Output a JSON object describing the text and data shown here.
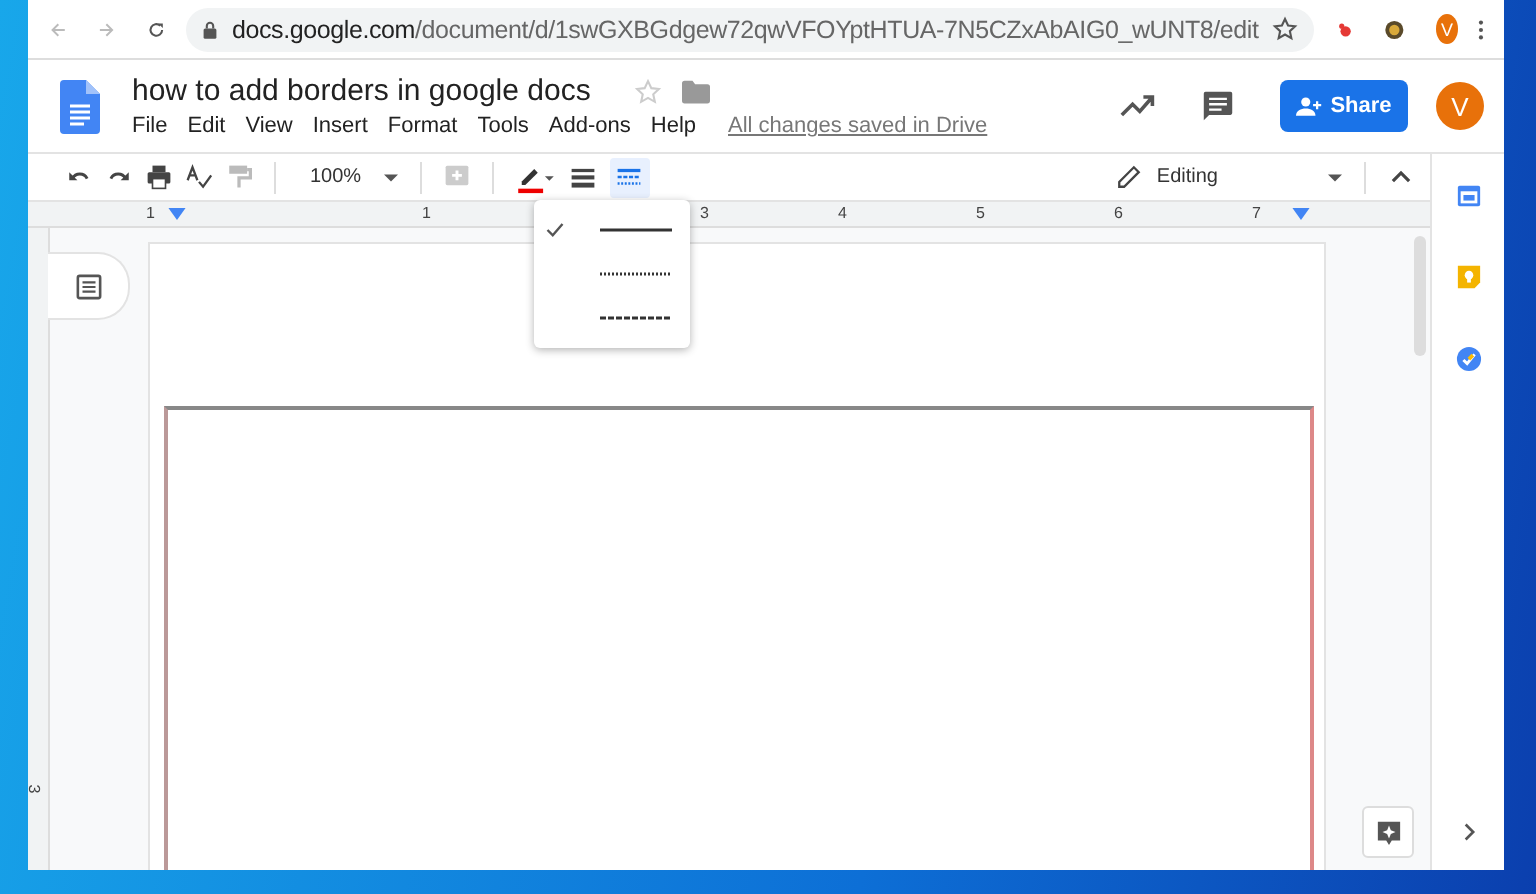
{
  "browser": {
    "url_host": "docs.google.com",
    "url_path": "/document/d/1swGXBGdgew72qwVFOYptHTUA-7N5CZxAbAIG0_wUNT8/edit",
    "profile_initial": "V"
  },
  "document": {
    "title": "how to add borders in google docs",
    "save_status": "All changes saved in Drive"
  },
  "menu": [
    "File",
    "Edit",
    "View",
    "Insert",
    "Format",
    "Tools",
    "Add-ons",
    "Help"
  ],
  "share_button": {
    "label": "Share"
  },
  "account": {
    "initial": "V"
  },
  "toolbar": {
    "zoom": "100%",
    "mode": "Editing",
    "border_dash_active": true
  },
  "ruler": {
    "labels": [
      "1",
      "1",
      "3",
      "4",
      "5",
      "6",
      "7"
    ],
    "vertical_labels": [
      "3"
    ]
  },
  "border_dash_menu": {
    "options": [
      {
        "kind": "solid",
        "selected": true
      },
      {
        "kind": "dotted",
        "selected": false
      },
      {
        "kind": "dashed",
        "selected": false
      }
    ]
  }
}
